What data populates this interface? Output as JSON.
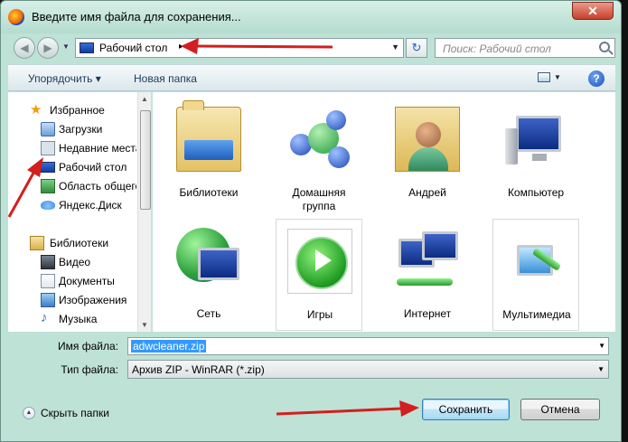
{
  "window": {
    "title": "Введите имя файла для сохранения...",
    "close_label": "✕"
  },
  "nav": {
    "back_label": "◀",
    "forward_label": "▶",
    "address_location": "Рабочий стол",
    "address_chevron": "▸",
    "refresh_label": "↻",
    "search_placeholder": "Поиск: Рабочий стол"
  },
  "toolbar": {
    "organize_label": "Упорядочить ▾",
    "new_folder_label": "Новая папка",
    "help_label": "?"
  },
  "sidebar": {
    "favorites": {
      "label": "Избранное",
      "items": [
        {
          "label": "Загрузки",
          "icon": "downloads-folder-icon"
        },
        {
          "label": "Недавние места",
          "icon": "recent-places-icon"
        },
        {
          "label": "Рабочий стол",
          "icon": "desktop-icon",
          "selected": true
        },
        {
          "label": "Область общего доступа",
          "icon": "shared-folder-icon"
        },
        {
          "label": "Яндекс.Диск",
          "icon": "yandex-disk-icon"
        }
      ]
    },
    "libraries": {
      "label": "Библиотеки",
      "items": [
        {
          "label": "Видео",
          "icon": "video-library-icon"
        },
        {
          "label": "Документы",
          "icon": "documents-library-icon"
        },
        {
          "label": "Изображения",
          "icon": "images-library-icon"
        },
        {
          "label": "Музыка",
          "icon": "music-library-icon"
        }
      ]
    }
  },
  "content": {
    "items": [
      {
        "label": "Библиотеки",
        "icon": "libraries-icon"
      },
      {
        "label": "Домашняя группа",
        "icon": "homegroup-icon"
      },
      {
        "label": "Андрей",
        "icon": "user-folder-icon"
      },
      {
        "label": "Компьютер",
        "icon": "computer-icon"
      },
      {
        "label": "Сеть",
        "icon": "network-icon"
      },
      {
        "label": "Игры",
        "icon": "games-icon"
      },
      {
        "label": "Интернет",
        "icon": "internet-icon"
      },
      {
        "label": "Мультимедиа",
        "icon": "multimedia-icon"
      }
    ]
  },
  "form": {
    "filename_label": "Имя файла:",
    "filename_value": "adwcleaner.zip",
    "filetype_label": "Тип файла:",
    "filetype_value": "Архив ZIP - WinRAR (*.zip)"
  },
  "footer": {
    "hide_folders_label": "Скрыть папки",
    "save_label": "Сохранить",
    "cancel_label": "Отмена"
  },
  "colors": {
    "chrome": "#bfe2d6",
    "selection": "#3399ff",
    "annotation_arrow": "#d21f1f"
  }
}
